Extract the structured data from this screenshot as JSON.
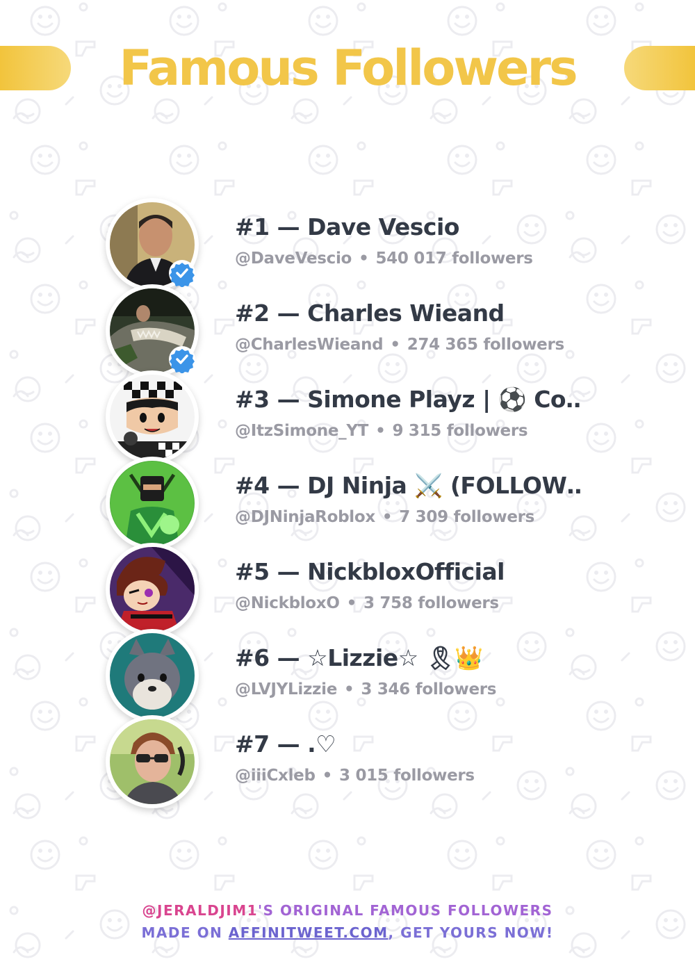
{
  "colors": {
    "accent_yellow": "#f2c649",
    "name_text": "#333a46",
    "meta_text": "#9a9aa3",
    "footer_pink": "#d9458f",
    "footer_purple": "#a264d4",
    "footer_indigo": "#7b6fd6",
    "verified_blue": "#3b94e8"
  },
  "header": {
    "title": "Famous Followers"
  },
  "followers": [
    {
      "rank": "#1",
      "name": "Dave Vescio",
      "handle": "@DaveVescio",
      "count": "540 017 followers",
      "verified": true,
      "avatar_icon": "photo-man-suit-icon"
    },
    {
      "rank": "#2",
      "name": "Charles Wieand",
      "handle": "@CharlesWieand",
      "count": "274 365 followers",
      "verified": true,
      "avatar_icon": "photo-dinosaur-icon"
    },
    {
      "rank": "#3",
      "name": "Simone Playz | ⚽ Co…",
      "handle": "@ItzSimone_YT",
      "count": "9 315 followers",
      "verified": false,
      "avatar_icon": "cartoon-checkered-hat-icon"
    },
    {
      "rank": "#4",
      "name": "DJ Ninja ⚔️ (FOLLOW…",
      "handle": "@DJNinjaRoblox",
      "count": "7 309 followers",
      "verified": false,
      "avatar_icon": "ninja-green-icon"
    },
    {
      "rank": "#5",
      "name": "NickbloxOfficial",
      "handle": "@NickbloxO",
      "count": "3 758 followers",
      "verified": false,
      "avatar_icon": "anime-character-icon"
    },
    {
      "rank": "#6",
      "name": "☆Lizzie☆ 🎗👑",
      "handle": "@LVJYLizzie",
      "count": "3 346 followers",
      "verified": false,
      "avatar_icon": "wolf-cartoon-icon"
    },
    {
      "rank": "#7",
      "name": ".♡",
      "handle": "@iiiCxleb",
      "count": "3 015 followers",
      "verified": false,
      "avatar_icon": "photo-sunglasses-icon"
    }
  ],
  "separator": "—",
  "bullet": "•",
  "footer": {
    "user": "@JERALDJIM1",
    "line1_rest": "'S ORIGINAL FAMOUS FOLLOWERS",
    "line2_prefix": "MADE ON ",
    "link": "AFFINITWEET.COM",
    "line2_suffix": ", GET YOURS NOW!"
  }
}
